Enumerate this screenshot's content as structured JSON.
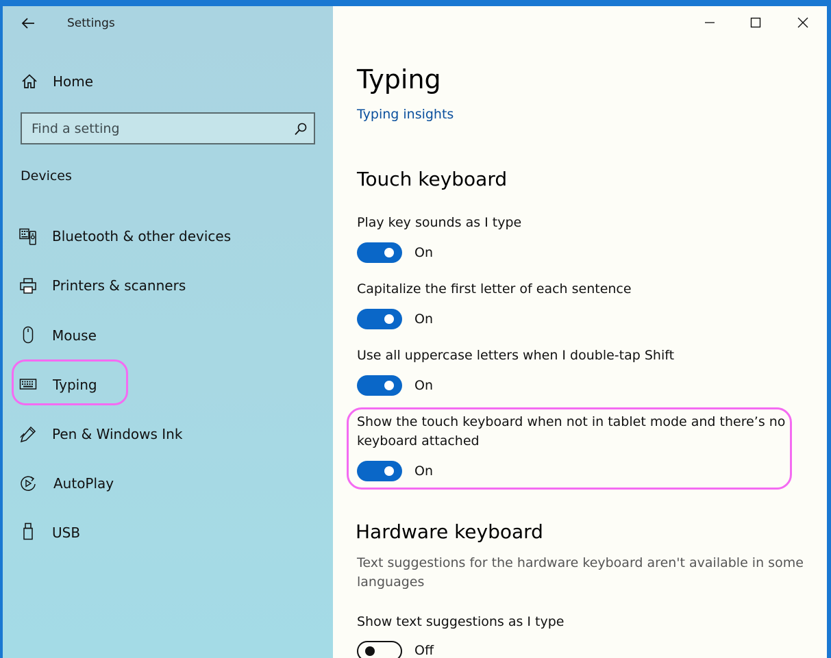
{
  "window": {
    "title": "Settings"
  },
  "sidebar": {
    "home_label": "Home",
    "search_placeholder": "Find a setting",
    "section_label": "Devices",
    "items": [
      {
        "label": "Bluetooth & other devices",
        "icon": "bluetooth-devices-icon"
      },
      {
        "label": "Printers & scanners",
        "icon": "printer-icon"
      },
      {
        "label": "Mouse",
        "icon": "mouse-icon"
      },
      {
        "label": "Typing",
        "icon": "keyboard-icon",
        "selected": true
      },
      {
        "label": "Pen & Windows Ink",
        "icon": "pen-icon"
      },
      {
        "label": "AutoPlay",
        "icon": "autoplay-icon"
      },
      {
        "label": "USB",
        "icon": "usb-icon"
      }
    ]
  },
  "main": {
    "title": "Typing",
    "insights_link": "Typing insights",
    "touch_keyboard": {
      "heading": "Touch keyboard",
      "settings": [
        {
          "label": "Play key sounds as I type",
          "state": "On"
        },
        {
          "label": "Capitalize the first letter of each sentence",
          "state": "On"
        },
        {
          "label": "Use all uppercase letters when I double-tap Shift",
          "state": "On"
        },
        {
          "label_line1": "Show the touch keyboard when not in tablet mode and there’s no",
          "label_line2": "keyboard attached",
          "state": "On"
        }
      ]
    },
    "hardware_keyboard": {
      "heading": "Hardware keyboard",
      "desc_line1": "Text suggestions for the hardware keyboard aren't available in some",
      "desc_line2": "languages",
      "suggestion_label": "Show text suggestions as I type",
      "suggestion_state": "Off"
    }
  },
  "colors": {
    "accent": "#0a67c8",
    "highlight": "#f46bf2",
    "link": "#0a4f9d"
  }
}
